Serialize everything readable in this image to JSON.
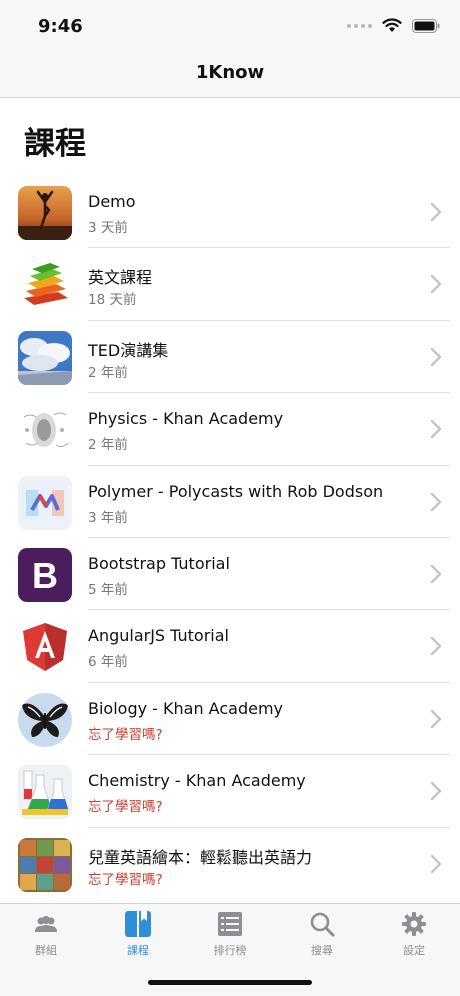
{
  "status_bar": {
    "time": "9:46"
  },
  "nav": {
    "title": "1Know"
  },
  "page": {
    "large_title": "課程"
  },
  "courses": [
    {
      "title": "Demo",
      "subtitle": "3 天前",
      "warn": false,
      "icon": "silhouette-sunset-thumbnail"
    },
    {
      "title": "英文課程",
      "subtitle": "18 天前",
      "warn": false,
      "icon": "book-stack-thumbnail"
    },
    {
      "title": "TED演講集",
      "subtitle": "2 年前",
      "warn": false,
      "icon": "cloud-sky-thumbnail"
    },
    {
      "title": "Physics - Khan Academy",
      "subtitle": "2 年前",
      "warn": false,
      "icon": "physics-sketch-thumbnail"
    },
    {
      "title": "Polymer - Polycasts with Rob Dodson",
      "subtitle": "3 年前",
      "warn": false,
      "icon": "polymer-logo-thumbnail"
    },
    {
      "title": "Bootstrap Tutorial",
      "subtitle": "5 年前",
      "warn": false,
      "icon": "bootstrap-logo-thumbnail"
    },
    {
      "title": "AngularJS Tutorial",
      "subtitle": "6 年前",
      "warn": false,
      "icon": "angular-logo-thumbnail"
    },
    {
      "title": "Biology - Khan Academy",
      "subtitle": "忘了學習嗎?",
      "warn": true,
      "icon": "butterfly-thumbnail"
    },
    {
      "title": "Chemistry - Khan Academy",
      "subtitle": "忘了學習嗎?",
      "warn": true,
      "icon": "lab-flasks-thumbnail"
    },
    {
      "title": "兒童英語繪本：輕鬆聽出英語力",
      "subtitle": "忘了學習嗎?",
      "warn": true,
      "icon": "picture-books-thumbnail"
    }
  ],
  "tabs": [
    {
      "label": "群組",
      "icon": "group-icon",
      "active": false
    },
    {
      "label": "課程",
      "icon": "book-icon",
      "active": true
    },
    {
      "label": "排行榜",
      "icon": "list-icon",
      "active": false
    },
    {
      "label": "搜尋",
      "icon": "search-icon",
      "active": false
    },
    {
      "label": "設定",
      "icon": "gear-icon",
      "active": false
    }
  ],
  "colors": {
    "accent": "#2f8fd8",
    "warn": "#d23a2e",
    "muted": "#8e8e93"
  }
}
